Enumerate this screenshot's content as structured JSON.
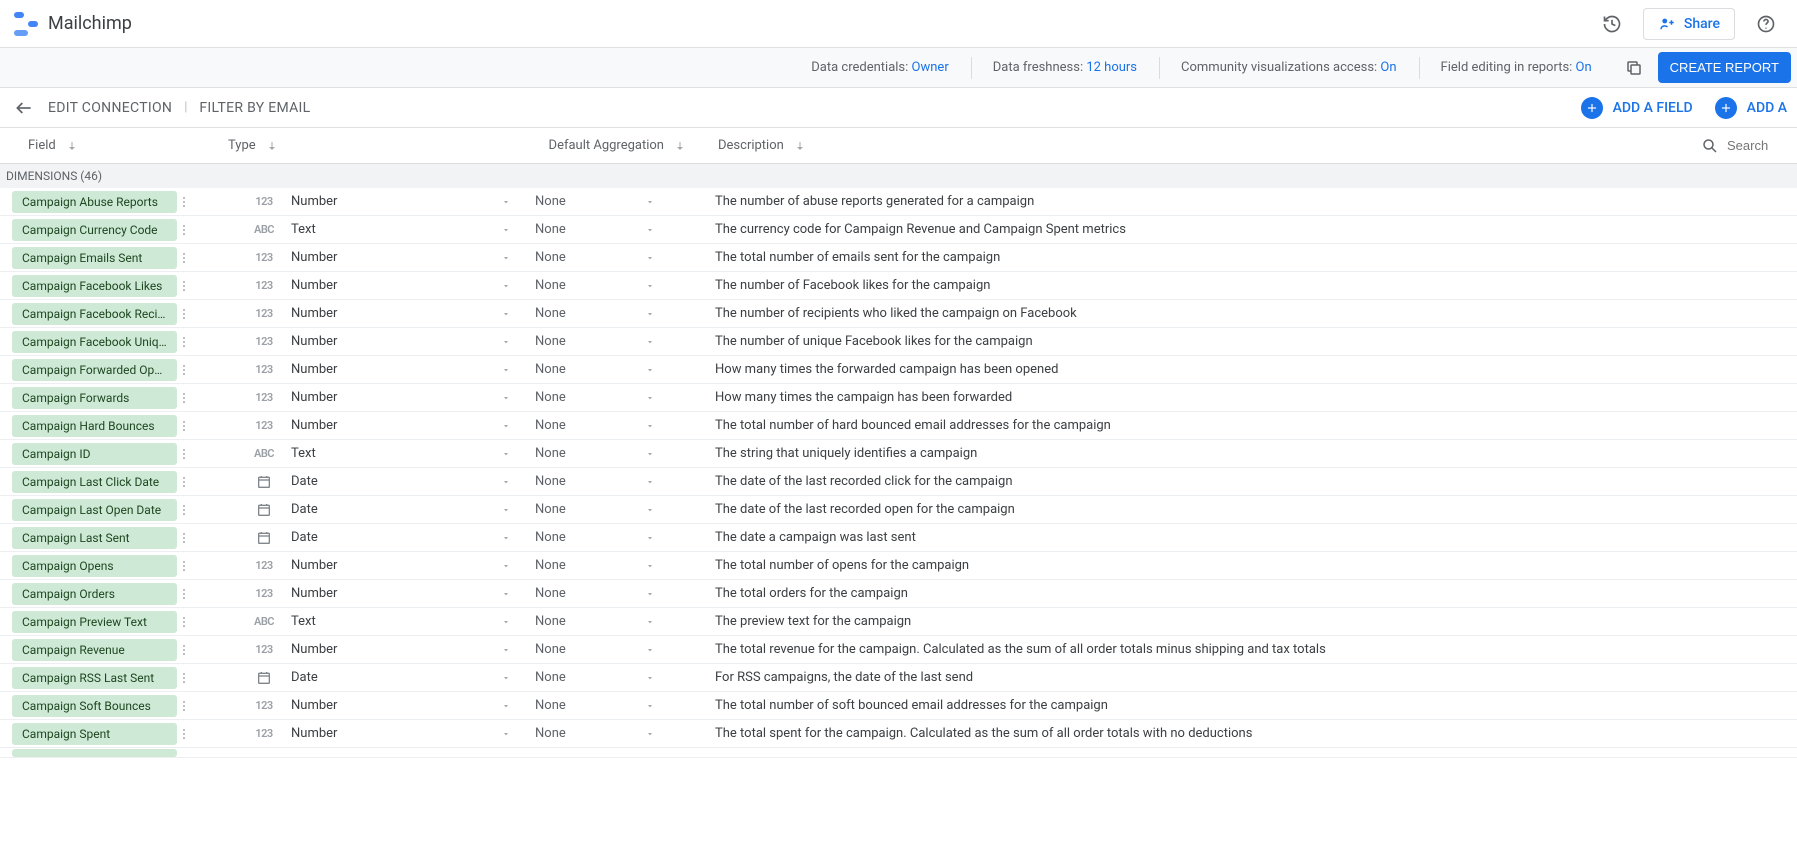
{
  "header": {
    "title": "Mailchimp",
    "share_label": "Share"
  },
  "infobar": {
    "credentials_label": "Data credentials:",
    "credentials_value": "Owner",
    "freshness_label": "Data freshness:",
    "freshness_value": "12 hours",
    "community_label": "Community visualizations access:",
    "community_value": "On",
    "field_edit_label": "Field editing in reports:",
    "field_edit_value": "On",
    "create_report": "CREATE REPORT"
  },
  "editbar": {
    "edit_connection": "EDIT CONNECTION",
    "filter": "FILTER BY EMAIL",
    "add_field": "ADD A FIELD",
    "add_param": "ADD A"
  },
  "columns": {
    "field": "Field",
    "type": "Type",
    "agg": "Default Aggregation",
    "desc": "Description",
    "search_placeholder": "Search"
  },
  "section_label": "DIMENSIONS (46)",
  "type_labels": {
    "number": "Number",
    "text": "Text",
    "date": "Date"
  },
  "agg_none": "None",
  "rows": [
    {
      "name": "Campaign Abuse Reports",
      "type": "number",
      "desc": "The number of abuse reports generated for a campaign"
    },
    {
      "name": "Campaign Currency Code",
      "type": "text",
      "desc": "The currency code for Campaign Revenue and Campaign Spent metrics"
    },
    {
      "name": "Campaign Emails Sent",
      "type": "number",
      "desc": "The total number of emails sent for the campaign"
    },
    {
      "name": "Campaign Facebook Likes",
      "type": "number",
      "desc": "The number of Facebook likes for the campaign"
    },
    {
      "name": "Campaign Facebook Reci…",
      "type": "number",
      "desc": "The number of recipients who liked the campaign on Facebook"
    },
    {
      "name": "Campaign Facebook Uniq…",
      "type": "number",
      "desc": "The number of unique Facebook likes for the campaign"
    },
    {
      "name": "Campaign Forwarded Op…",
      "type": "number",
      "desc": "How many times the forwarded campaign has been opened"
    },
    {
      "name": "Campaign Forwards",
      "type": "number",
      "desc": "How many times the campaign has been forwarded"
    },
    {
      "name": "Campaign Hard Bounces",
      "type": "number",
      "desc": "The total number of hard bounced email addresses for the campaign"
    },
    {
      "name": "Campaign ID",
      "type": "text",
      "desc": "The string that uniquely identifies a campaign"
    },
    {
      "name": "Campaign Last Click Date",
      "type": "date",
      "desc": "The date of the last recorded click for the campaign"
    },
    {
      "name": "Campaign Last Open Date",
      "type": "date",
      "desc": "The date of the last recorded open for the campaign"
    },
    {
      "name": "Campaign Last Sent",
      "type": "date",
      "desc": "The date a campaign was last sent"
    },
    {
      "name": "Campaign Opens",
      "type": "number",
      "desc": "The total number of opens for the campaign"
    },
    {
      "name": "Campaign Orders",
      "type": "number",
      "desc": "The total orders for the campaign"
    },
    {
      "name": "Campaign Preview Text",
      "type": "text",
      "desc": "The preview text for the campaign"
    },
    {
      "name": "Campaign Revenue",
      "type": "number",
      "desc": "The total revenue for the campaign. Calculated as the sum of all order totals minus shipping and tax totals"
    },
    {
      "name": "Campaign RSS Last Sent",
      "type": "date",
      "desc": "For RSS campaigns, the date of the last send"
    },
    {
      "name": "Campaign Soft Bounces",
      "type": "number",
      "desc": "The total number of soft bounced email addresses for the campaign"
    },
    {
      "name": "Campaign Spent",
      "type": "number",
      "desc": "The total spent for the campaign. Calculated as the sum of all order totals with no deductions"
    }
  ]
}
